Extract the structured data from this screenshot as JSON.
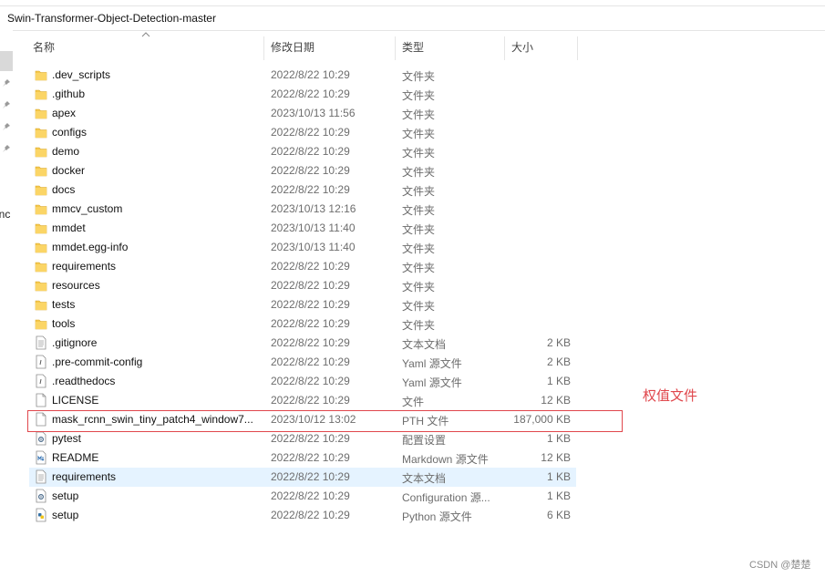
{
  "pathbar": {
    "text": "Swin-Transformer-Object-Detection-master"
  },
  "nav": {
    "cut_text": "enc"
  },
  "columns": {
    "name": "名称",
    "date": "修改日期",
    "type": "类型",
    "size": "大小"
  },
  "rows": [
    {
      "name": ".dev_scripts",
      "date": "2022/8/22 10:29",
      "type": "文件夹",
      "size": "",
      "icon": "folder"
    },
    {
      "name": ".github",
      "date": "2022/8/22 10:29",
      "type": "文件夹",
      "size": "",
      "icon": "folder"
    },
    {
      "name": "apex",
      "date": "2023/10/13 11:56",
      "type": "文件夹",
      "size": "",
      "icon": "folder"
    },
    {
      "name": "configs",
      "date": "2022/8/22 10:29",
      "type": "文件夹",
      "size": "",
      "icon": "folder"
    },
    {
      "name": "demo",
      "date": "2022/8/22 10:29",
      "type": "文件夹",
      "size": "",
      "icon": "folder"
    },
    {
      "name": "docker",
      "date": "2022/8/22 10:29",
      "type": "文件夹",
      "size": "",
      "icon": "folder"
    },
    {
      "name": "docs",
      "date": "2022/8/22 10:29",
      "type": "文件夹",
      "size": "",
      "icon": "folder"
    },
    {
      "name": "mmcv_custom",
      "date": "2023/10/13 12:16",
      "type": "文件夹",
      "size": "",
      "icon": "folder"
    },
    {
      "name": "mmdet",
      "date": "2023/10/13 11:40",
      "type": "文件夹",
      "size": "",
      "icon": "folder"
    },
    {
      "name": "mmdet.egg-info",
      "date": "2023/10/13 11:40",
      "type": "文件夹",
      "size": "",
      "icon": "folder"
    },
    {
      "name": "requirements",
      "date": "2022/8/22 10:29",
      "type": "文件夹",
      "size": "",
      "icon": "folder"
    },
    {
      "name": "resources",
      "date": "2022/8/22 10:29",
      "type": "文件夹",
      "size": "",
      "icon": "folder"
    },
    {
      "name": "tests",
      "date": "2022/8/22 10:29",
      "type": "文件夹",
      "size": "",
      "icon": "folder"
    },
    {
      "name": "tools",
      "date": "2022/8/22 10:29",
      "type": "文件夹",
      "size": "",
      "icon": "folder"
    },
    {
      "name": ".gitignore",
      "date": "2022/8/22 10:29",
      "type": "文本文档",
      "size": "2 KB",
      "icon": "text"
    },
    {
      "name": ".pre-commit-config",
      "date": "2022/8/22 10:29",
      "type": "Yaml 源文件",
      "size": "2 KB",
      "icon": "yaml"
    },
    {
      "name": ".readthedocs",
      "date": "2022/8/22 10:29",
      "type": "Yaml 源文件",
      "size": "1 KB",
      "icon": "yaml"
    },
    {
      "name": "LICENSE",
      "date": "2022/8/22 10:29",
      "type": "文件",
      "size": "12 KB",
      "icon": "blank"
    },
    {
      "name": "mask_rcnn_swin_tiny_patch4_window7...",
      "date": "2023/10/12 13:02",
      "type": "PTH 文件",
      "size": "187,000 KB",
      "icon": "blank"
    },
    {
      "name": "pytest",
      "date": "2022/8/22 10:29",
      "type": "配置设置",
      "size": "1 KB",
      "icon": "config"
    },
    {
      "name": "README",
      "date": "2022/8/22 10:29",
      "type": "Markdown 源文件",
      "size": "12 KB",
      "icon": "markdown"
    },
    {
      "name": "requirements",
      "date": "2022/8/22 10:29",
      "type": "文本文档",
      "size": "1 KB",
      "icon": "text",
      "selected": true
    },
    {
      "name": "setup",
      "date": "2022/8/22 10:29",
      "type": "Configuration 源...",
      "size": "1 KB",
      "icon": "config"
    },
    {
      "name": "setup",
      "date": "2022/8/22 10:29",
      "type": "Python 源文件",
      "size": "6 KB",
      "icon": "python"
    }
  ],
  "annotation": {
    "text": "权值文件",
    "color": "#e0474c"
  },
  "watermark": {
    "text": "CSDN @楚楚"
  },
  "colors": {
    "folder": "#f5c84c",
    "selection": "#e5f3ff",
    "highlight": "#e0474c"
  }
}
